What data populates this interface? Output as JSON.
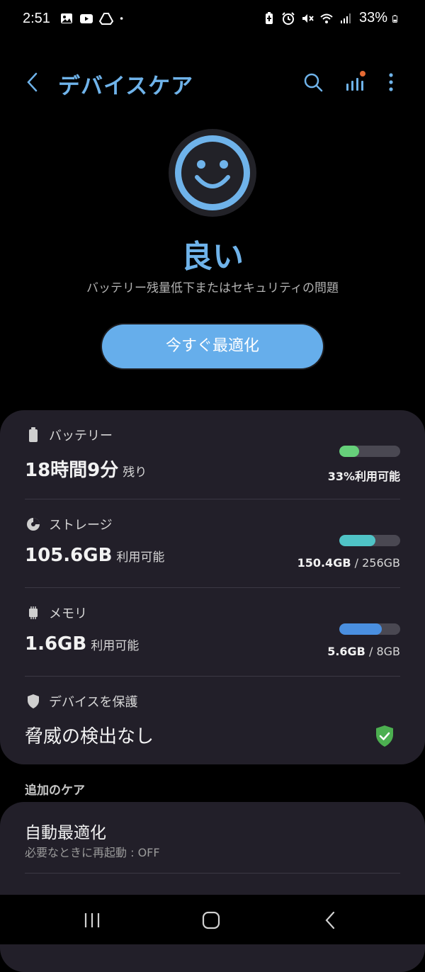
{
  "status_bar": {
    "time": "2:51",
    "battery_text": "33%",
    "left_icons": [
      "gallery-icon",
      "youtube-icon",
      "drive-icon",
      "dot-icon"
    ],
    "right_icons": [
      "battery-saver-icon",
      "alarm-icon",
      "mute-icon",
      "wifi-icon",
      "signal-icon",
      "battery-icon"
    ]
  },
  "app_bar": {
    "title": "デバイスケア",
    "actions": [
      "search-icon",
      "stats-icon",
      "more-options-icon"
    ]
  },
  "summary": {
    "status": "良い",
    "detail": "バッテリー残量低下またはセキュリティの問題",
    "optimize_label": "今すぐ最適化"
  },
  "sections": {
    "battery": {
      "label": "バッテリー",
      "value": "18時間9分",
      "value_suffix": "残り",
      "meter_fraction": 0.33,
      "meter_color": "#66d07a",
      "caption_strong": "33%利用可能",
      "caption_rest": ""
    },
    "storage": {
      "label": "ストレージ",
      "value": "105.6GB",
      "value_suffix": "利用可能",
      "meter_fraction": 0.59,
      "meter_color": "#4fc3c6",
      "caption_strong": "150.4GB",
      "caption_rest": " / 256GB"
    },
    "memory": {
      "label": "メモリ",
      "value": "1.6GB",
      "value_suffix": "利用可能",
      "meter_fraction": 0.7,
      "meter_color": "#4a8fe0",
      "caption_strong": "5.6GB",
      "caption_rest": " / 8GB"
    },
    "protection": {
      "label": "デバイスを保護",
      "value": "脅威の検出なし"
    }
  },
  "additional": {
    "heading": "追加のケア",
    "items": [
      {
        "title": "自動最適化",
        "subtitle": "必要なときに再起動 : OFF"
      }
    ]
  },
  "colors": {
    "accent": "#6fb3ea",
    "button": "#66aeeb",
    "card": "#221f29",
    "shield_ok": "#4caf50"
  }
}
